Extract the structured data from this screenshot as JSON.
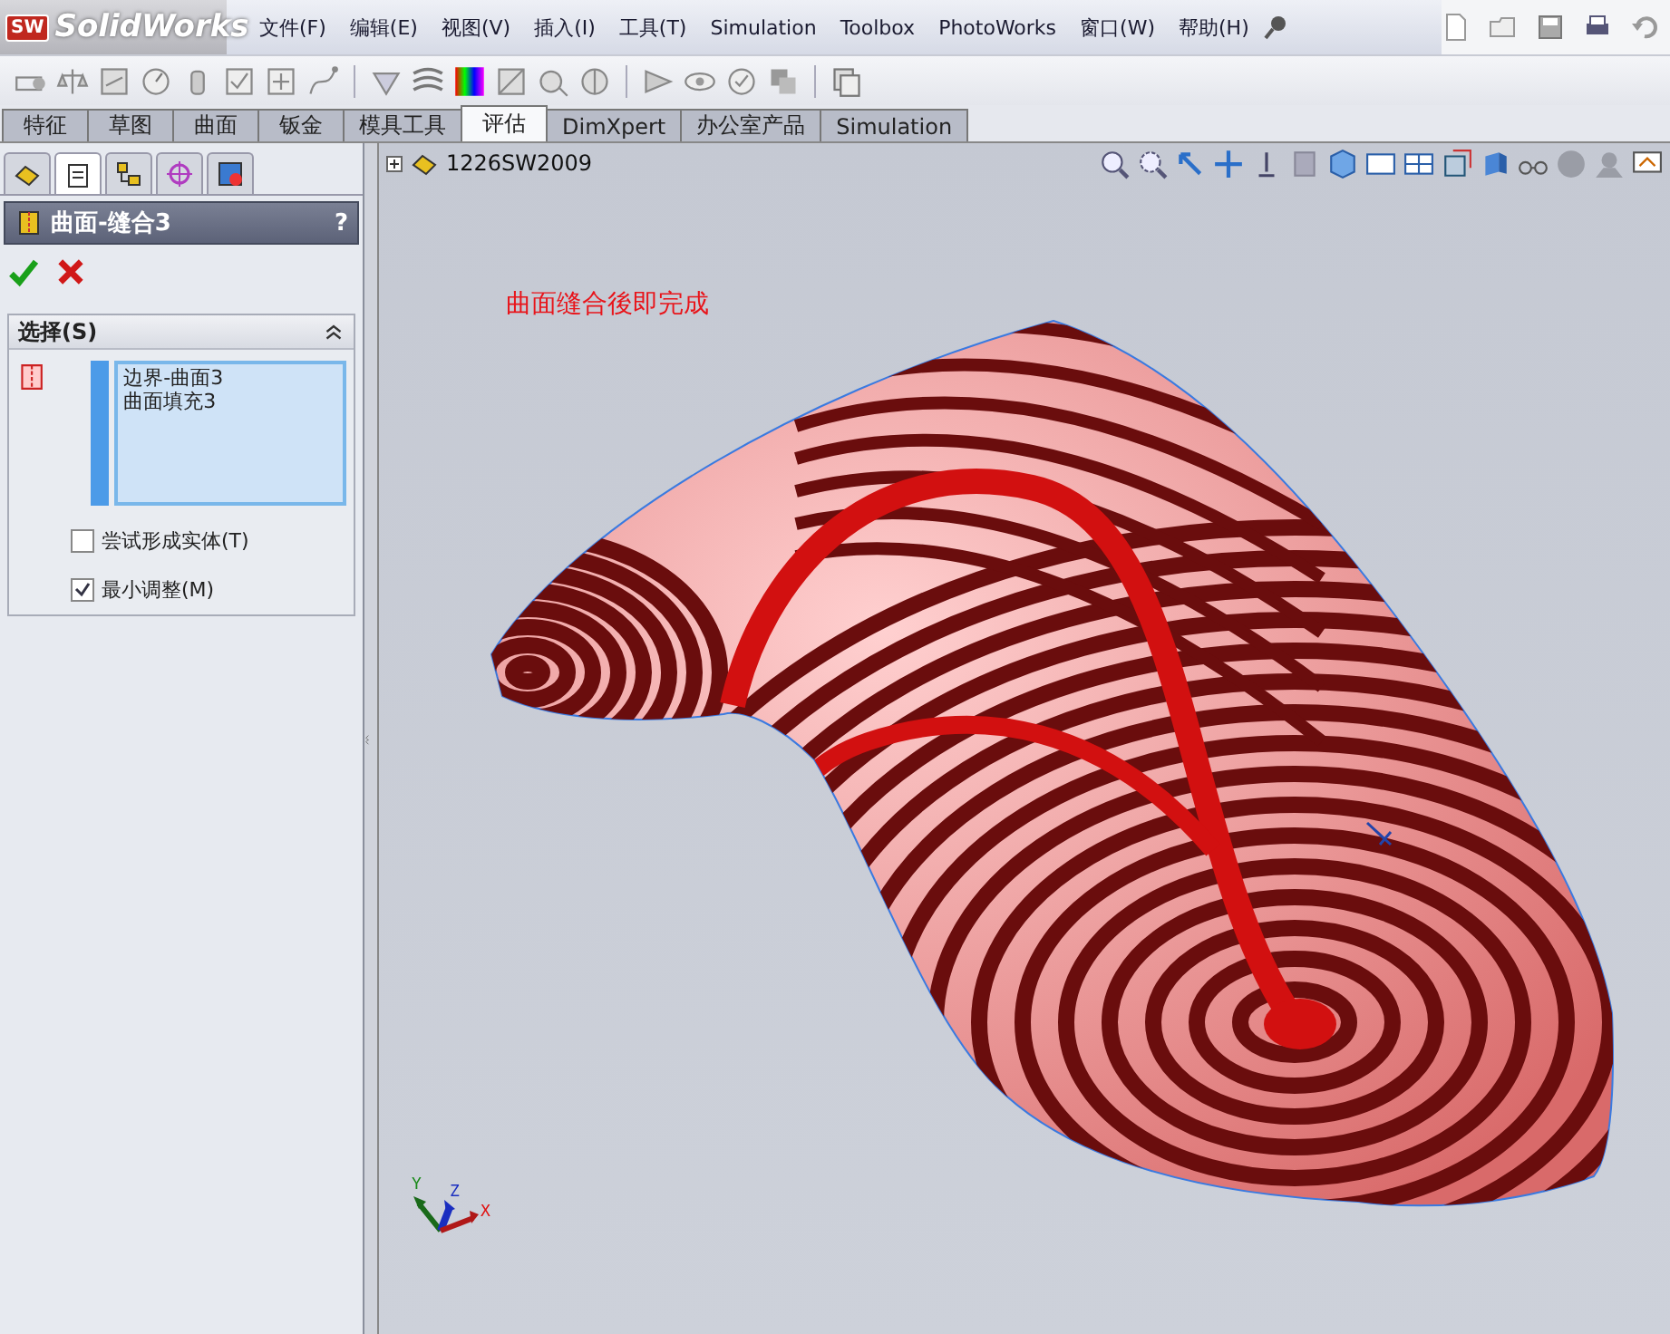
{
  "app": {
    "logo_badge": "SW",
    "logo": "SolidWorks"
  },
  "menu": [
    "文件(F)",
    "编辑(E)",
    "视图(V)",
    "插入(I)",
    "工具(T)",
    "Simulation",
    "Toolbox",
    "PhotoWorks",
    "窗口(W)",
    "帮助(H)"
  ],
  "tabs": [
    {
      "label": "特征",
      "selected": false
    },
    {
      "label": "草图",
      "selected": false
    },
    {
      "label": "曲面",
      "selected": false
    },
    {
      "label": "钣金",
      "selected": false
    },
    {
      "label": "模具工具",
      "selected": false
    },
    {
      "label": "评估",
      "selected": true
    },
    {
      "label": "DimXpert",
      "selected": false
    },
    {
      "label": "办公室产品",
      "selected": false
    },
    {
      "label": "Simulation",
      "selected": false
    }
  ],
  "panel_tabs": [
    {
      "kind": "feature",
      "selected": false
    },
    {
      "kind": "property",
      "selected": true
    },
    {
      "kind": "config",
      "selected": false
    },
    {
      "kind": "dim",
      "selected": false
    },
    {
      "kind": "display",
      "selected": false
    }
  ],
  "property": {
    "title": "曲面-缝合3",
    "help": "?"
  },
  "section": {
    "title": "选择(S)",
    "expanded": true,
    "selections": [
      "边界-曲面3",
      "曲面填充3"
    ]
  },
  "options": [
    {
      "label": "尝试形成实体(T)",
      "checked": false
    },
    {
      "label": "最小调整(M)",
      "checked": true
    }
  ],
  "tree": {
    "root": "1226SW2009",
    "expanded": false
  },
  "annotation": "曲面缝合後即完成",
  "triad": {
    "x": "X",
    "y": "Y",
    "z": "Z"
  }
}
